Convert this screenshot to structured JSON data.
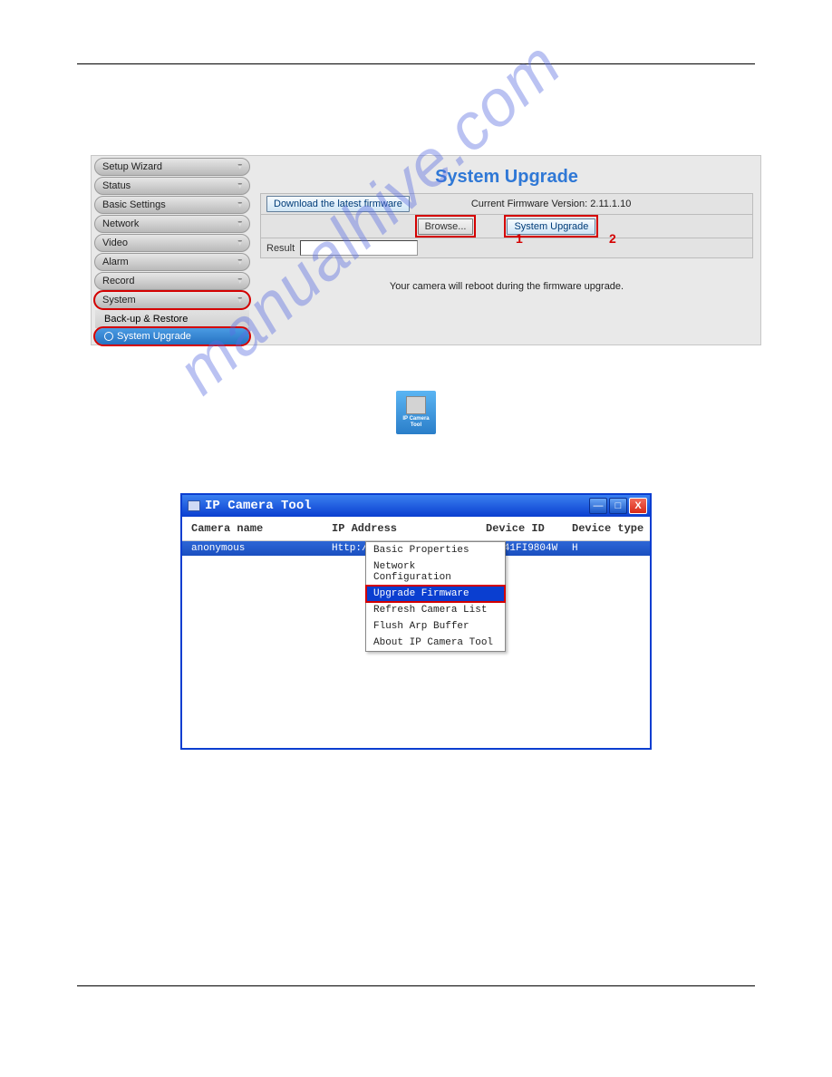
{
  "watermark": "manualhive.com",
  "fig1": {
    "title": "System Upgrade",
    "menu": [
      "Setup Wizard",
      "Status",
      "Basic Settings",
      "Network",
      "Video",
      "Alarm",
      "Record",
      "System"
    ],
    "sub1": "Back-up & Restore",
    "sub2": "System Upgrade",
    "download_btn": "Download the latest firmware",
    "version_label": "Current Firmware Version: 2.11.1.10",
    "browse_btn": "Browse...",
    "upgrade_btn": "System Upgrade",
    "num1": "1",
    "num2": "2",
    "result_label": "Result",
    "reboot_text": "Your camera will reboot during the firmware upgrade."
  },
  "icon": {
    "label_l1": "IP Camera",
    "label_l2": "Tool"
  },
  "fig2": {
    "title": "IP Camera Tool",
    "col_name": "Camera name",
    "col_ip": "IP Address",
    "col_dev": "Device ID",
    "col_type": "Device type",
    "row": {
      "name": "anonymous",
      "ip": "Http://1",
      "dev": "10841FI9804W",
      "type": "H"
    },
    "menu": {
      "i0": "Basic Properties",
      "i1": "Network Configuration",
      "i2": "Upgrade Firmware",
      "i3": "Refresh Camera List",
      "i4": "Flush Arp Buffer",
      "i5": "About IP Camera Tool"
    },
    "min": "—",
    "max": "□",
    "close": "X"
  }
}
